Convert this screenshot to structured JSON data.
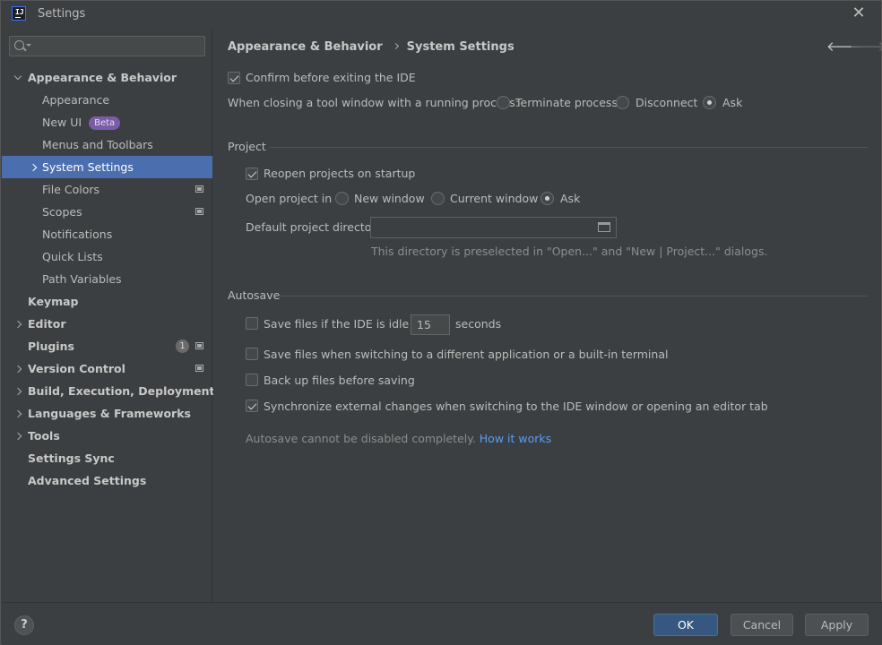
{
  "window": {
    "title": "Settings"
  },
  "sidebar": {
    "search_placeholder": "",
    "items": [
      {
        "label": "Appearance & Behavior",
        "level": 0,
        "expand": "down"
      },
      {
        "label": "Appearance",
        "level": 1
      },
      {
        "label": "New UI",
        "level": 1,
        "badge": "Beta"
      },
      {
        "label": "Menus and Toolbars",
        "level": 1
      },
      {
        "label": "System Settings",
        "level": 1,
        "expand": "right",
        "selected": true
      },
      {
        "label": "File Colors",
        "level": 1,
        "icon": "project-scope-icon"
      },
      {
        "label": "Scopes",
        "level": 1,
        "icon": "project-scope-icon"
      },
      {
        "label": "Notifications",
        "level": 1
      },
      {
        "label": "Quick Lists",
        "level": 1
      },
      {
        "label": "Path Variables",
        "level": 1
      },
      {
        "label": "Keymap",
        "level": 0
      },
      {
        "label": "Editor",
        "level": 0,
        "expand": "right"
      },
      {
        "label": "Plugins",
        "level": 0,
        "count": "1",
        "icon": "project-scope-icon"
      },
      {
        "label": "Version Control",
        "level": 0,
        "expand": "right",
        "icon": "project-scope-icon"
      },
      {
        "label": "Build, Execution, Deployment",
        "level": 0,
        "expand": "right"
      },
      {
        "label": "Languages & Frameworks",
        "level": 0,
        "expand": "right"
      },
      {
        "label": "Tools",
        "level": 0,
        "expand": "right"
      },
      {
        "label": "Settings Sync",
        "level": 0
      },
      {
        "label": "Advanced Settings",
        "level": 0
      }
    ]
  },
  "breadcrumb": {
    "parent": "Appearance & Behavior",
    "current": "System Settings"
  },
  "general": {
    "confirm_exit": {
      "label": "Confirm before exiting the IDE",
      "checked": true
    },
    "closing_label": "When closing a tool window with a running process:",
    "closing_options": [
      {
        "label": "Terminate process",
        "checked": false
      },
      {
        "label": "Disconnect",
        "checked": false
      },
      {
        "label": "Ask",
        "checked": true
      }
    ]
  },
  "project": {
    "title": "Project",
    "reopen": {
      "label": "Reopen projects on startup",
      "checked": true
    },
    "open_in_label": "Open project in",
    "open_in_options": [
      {
        "label": "New window",
        "checked": false
      },
      {
        "label": "Current window",
        "checked": false
      },
      {
        "label": "Ask",
        "checked": true
      }
    ],
    "default_dir_label": "Default project directory:",
    "default_dir_value": "",
    "default_dir_hint": "This directory is preselected in \"Open...\" and \"New | Project...\" dialogs."
  },
  "autosave": {
    "title": "Autosave",
    "idle_prefix": "Save files if the IDE is idle for",
    "idle_value": "15",
    "idle_suffix": "seconds",
    "idle_checked": false,
    "switch_app": {
      "label": "Save files when switching to a different application or a built-in terminal",
      "checked": false
    },
    "backup": {
      "label": "Back up files before saving",
      "checked": false
    },
    "sync_external": {
      "label": "Synchronize external changes when switching to the IDE window or opening an editor tab",
      "checked": true
    },
    "note": "Autosave cannot be disabled completely.",
    "note_link": "How it works"
  },
  "buttons": {
    "help": "?",
    "ok": "OK",
    "cancel": "Cancel",
    "apply": "Apply"
  },
  "colors": {
    "accent": "#4b6eaf",
    "primary_button": "#365880",
    "link": "#589df6",
    "beta_badge": "#7b5ca8"
  }
}
